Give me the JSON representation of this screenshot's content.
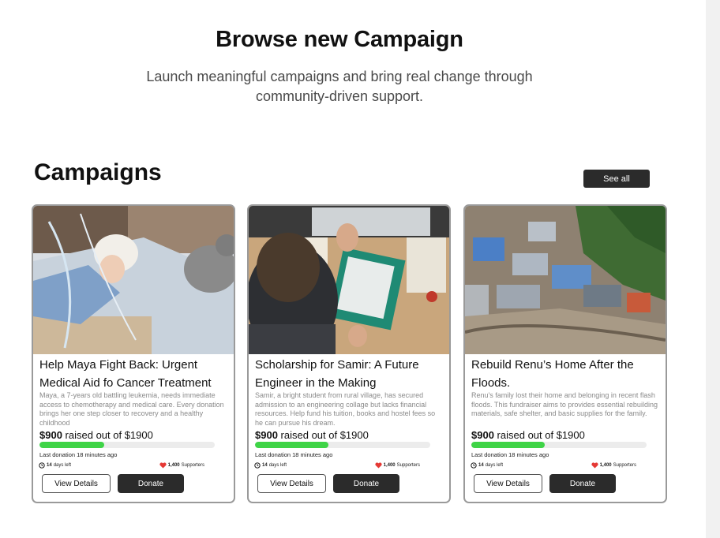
{
  "hero": {
    "title": "Browse new Campaign",
    "subtitle": "Launch meaningful campaigns and bring real change through community-driven support."
  },
  "section": {
    "title": "Campaigns",
    "see_all_label": "See all"
  },
  "campaigns": [
    {
      "title": "Help Maya Fight Back: Urgent Medical Aid fo Cancer Treatment",
      "description": "Maya, a 7-years old battling leukemia, needs immediate access to chemotherapy and medical care. Every donation brings her one step closer to recovery and a healthy childhood",
      "raised_amount": "$900",
      "raised_suffix": "raised out of $1900",
      "progress": 0.37,
      "last_donation": "Last donation 18 minutes ago",
      "days_number": "14",
      "days_label": "days left",
      "supporters_number": "1,400",
      "supporters_label": "Supporters",
      "view_label": "View Details",
      "donate_label": "Donate"
    },
    {
      "title": "Scholarship for Samir: A Future Engineer in the Making",
      "description": "Samir, a bright student from rural village, has secured admission to an engineering collage but lacks financial resources. Help fund his tuition, books and hostel fees so he can pursue his dream.",
      "raised_amount": "$900",
      "raised_suffix": "raised out of $1900",
      "progress": 0.42,
      "last_donation": "Last donation 18 minutes ago",
      "days_number": "14",
      "days_label": "days left",
      "supporters_number": "1,400",
      "supporters_label": "Supporters",
      "view_label": "View Details",
      "donate_label": "Donate"
    },
    {
      "title": "Rebuild Renu’s Home After the Floods.",
      "description": "Renu's family lost their home and belonging in recent flash floods. This fundraiser aims to provides essential rebuilding materials, safe shelter, and basic supplies for the family.",
      "raised_amount": "$900",
      "raised_suffix": "raised out of $1900",
      "progress": 0.42,
      "last_donation": "Last donation 18 minutes ago",
      "days_number": "14",
      "days_label": "days left",
      "supporters_number": "1,400",
      "supporters_label": "Supporters",
      "view_label": "View Details",
      "donate_label": "Donate"
    }
  ],
  "colors": {
    "progress_fill": "#3fd447",
    "button_dark": "#2b2b2b",
    "heart": "#e53935"
  },
  "icons": {
    "clock": "clock-icon",
    "heart": "heart-icon"
  }
}
